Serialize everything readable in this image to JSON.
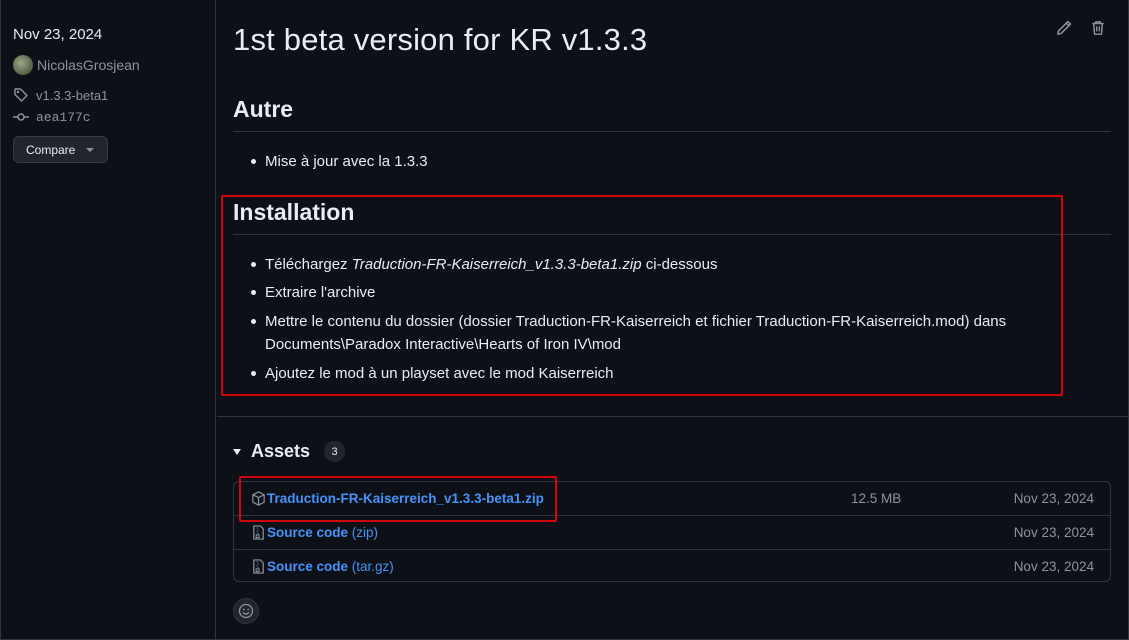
{
  "sidebar": {
    "date": "Nov 23, 2024",
    "author": "NicolasGrosjean",
    "tag": "v1.3.3-beta1",
    "commit": "aea177c",
    "compare_label": "Compare"
  },
  "release": {
    "title": "1st beta version for KR v1.3.3",
    "sections": [
      {
        "heading": "Autre",
        "items": [
          "Mise à jour avec la 1.3.3"
        ]
      },
      {
        "heading": "Installation",
        "items": [
          {
            "prefix": "Téléchargez ",
            "emph": "Traduction-FR-Kaiserreich_v1.3.3-beta1.zip",
            "suffix": " ci-dessous"
          },
          "Extraire l'archive",
          "Mettre le contenu du dossier (dossier Traduction-FR-Kaiserreich et fichier Traduction-FR-Kaiserreich.mod) dans Documents\\Paradox Interactive\\Hearts of Iron IV\\mod",
          "Ajoutez le mod à un playset avec le mod Kaiserreich"
        ]
      }
    ]
  },
  "assets": {
    "title": "Assets",
    "count": "3",
    "items": [
      {
        "name": "Traduction-FR-Kaiserreich_v1.3.3-beta1.zip",
        "sub": "",
        "size": "12.5 MB",
        "date": "Nov 23, 2024",
        "icon": "package-icon"
      },
      {
        "name": "Source code",
        "sub": " (zip)",
        "size": "",
        "date": "Nov 23, 2024",
        "icon": "file-zip-icon"
      },
      {
        "name": "Source code",
        "sub": " (tar.gz)",
        "size": "",
        "date": "Nov 23, 2024",
        "icon": "file-zip-icon"
      }
    ]
  },
  "colors": {
    "background": "#0d1117",
    "link": "#4493f8",
    "muted": "#8b949e",
    "highlight": "#d1060a"
  }
}
